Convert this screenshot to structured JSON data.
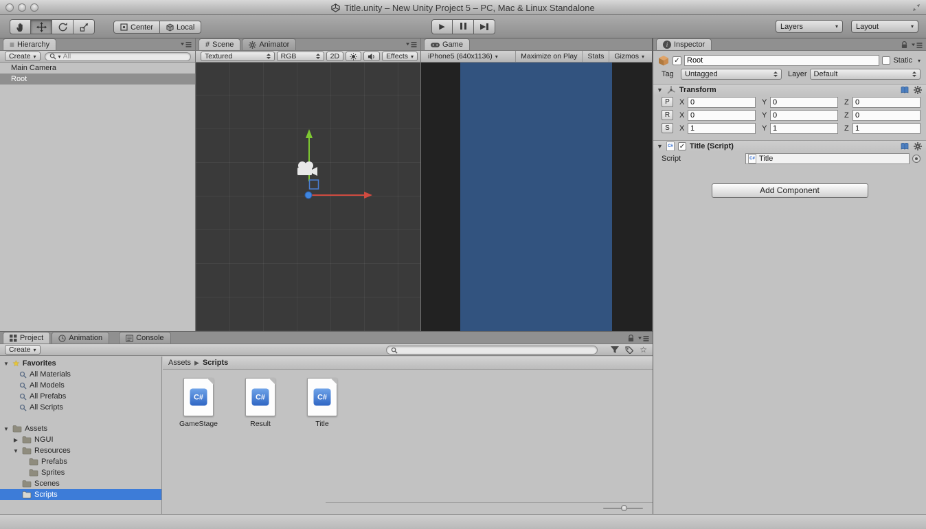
{
  "titlebar": {
    "title": "Title.unity – New Unity Project 5 – PC, Mac & Linux Standalone"
  },
  "toolbar": {
    "center": "Center",
    "local": "Local",
    "layers": "Layers",
    "layout": "Layout"
  },
  "hierarchy": {
    "tab": "Hierarchy",
    "create": "Create",
    "search_placeholder": "All",
    "items": [
      {
        "label": "Main Camera"
      },
      {
        "label": "Root"
      }
    ]
  },
  "scene": {
    "tab": "Scene",
    "animator_tab": "Animator",
    "shading": "Textured",
    "channel": "RGB",
    "mode2d": "2D",
    "effects": "Effects"
  },
  "game": {
    "tab": "Game",
    "aspect": "iPhone5 (640x1136)",
    "maximize": "Maximize on Play",
    "stats": "Stats",
    "gizmos": "Gizmos"
  },
  "inspector": {
    "tab": "Inspector",
    "name": "Root",
    "static_label": "Static",
    "tag_label": "Tag",
    "tag": "Untagged",
    "layer_label": "Layer",
    "layer": "Default",
    "transform": {
      "title": "Transform",
      "axes": [
        "X",
        "Y",
        "Z"
      ],
      "rows": [
        {
          "key": "P",
          "x": "0",
          "y": "0",
          "z": "0"
        },
        {
          "key": "R",
          "x": "0",
          "y": "0",
          "z": "0"
        },
        {
          "key": "S",
          "x": "1",
          "y": "1",
          "z": "1"
        }
      ]
    },
    "script": {
      "title": "Title (Script)",
      "label": "Script",
      "value": "Title"
    },
    "add_component": "Add Component"
  },
  "project": {
    "tab": "Project",
    "animation_tab": "Animation",
    "console_tab": "Console",
    "create": "Create",
    "tree": {
      "favorites_label": "Favorites",
      "favorites": [
        "All Materials",
        "All Models",
        "All Prefabs",
        "All Scripts"
      ],
      "assets_label": "Assets",
      "children": [
        "NGUI",
        "Resources",
        "Prefabs",
        "Sprites",
        "Scenes",
        "Scripts"
      ]
    },
    "breadcrumb": {
      "root": "Assets",
      "current": "Scripts"
    },
    "script_icon_label": "C#",
    "files": [
      "GameStage",
      "Result",
      "Title"
    ]
  }
}
